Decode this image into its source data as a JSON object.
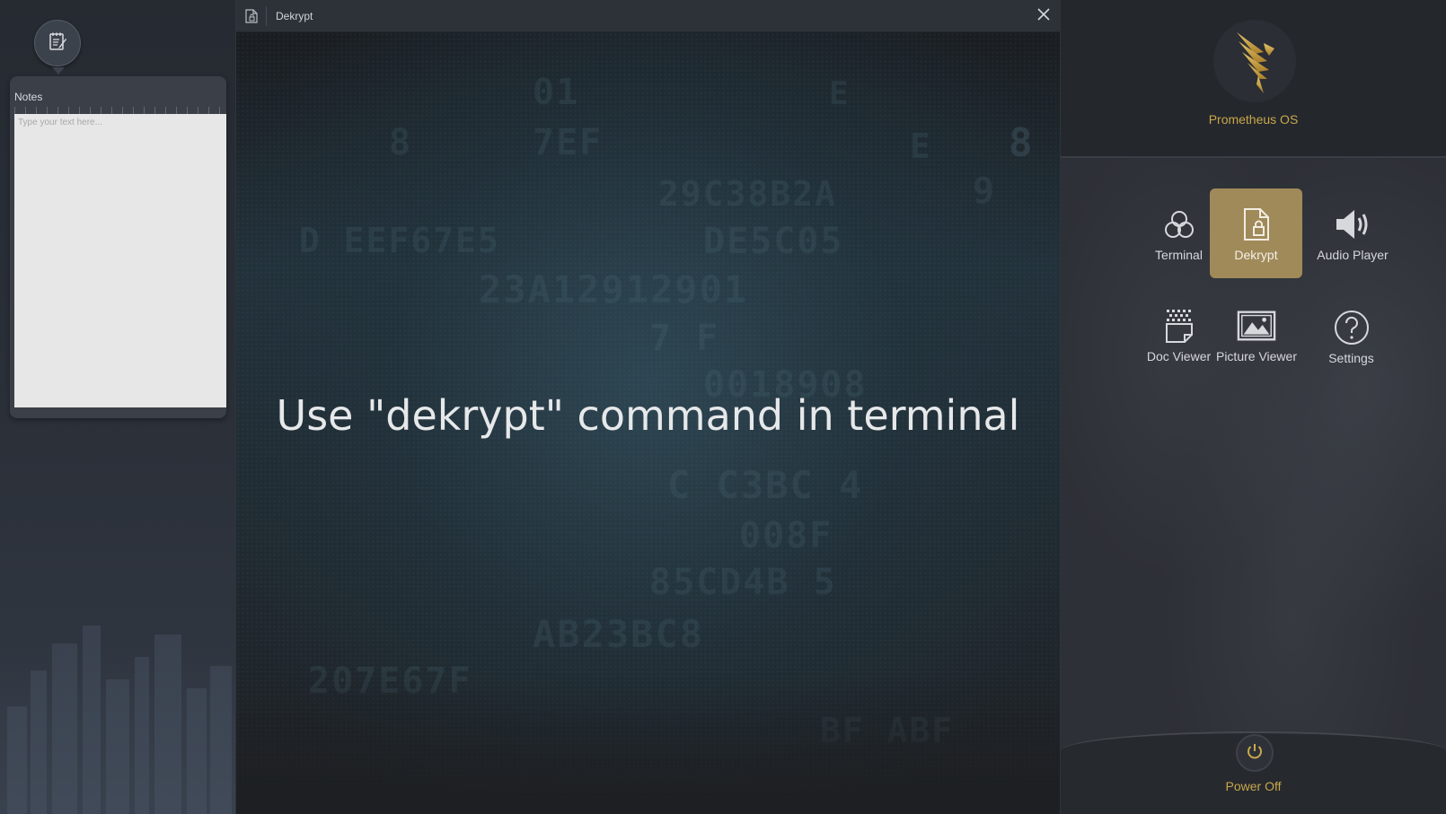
{
  "notes": {
    "title": "Notes",
    "placeholder": "Type your text here...",
    "toggle_icon": "notepad-icon"
  },
  "window": {
    "title": "Dekrypt",
    "title_icon": "file-lock-icon",
    "close_icon": "close-icon",
    "message": "Use \"dekrypt\" command in terminal"
  },
  "launcher": {
    "brand": "Prometheus OS",
    "logo_icon": "phoenix-logo-icon",
    "accent_color": "#c9a74c",
    "active_color": "#a08a5a",
    "apps": [
      {
        "label": "Terminal",
        "icon": "terminal-swirl-icon",
        "active": false
      },
      {
        "label": "Dekrypt",
        "icon": "file-lock-icon",
        "active": true
      },
      {
        "label": "Audio Player",
        "icon": "speaker-icon",
        "active": false
      },
      {
        "label": "Doc Viewer",
        "icon": "document-icon",
        "active": false
      },
      {
        "label": "Picture Viewer",
        "icon": "image-icon",
        "active": false
      },
      {
        "label": "Settings",
        "icon": "question-icon",
        "active": false
      }
    ],
    "power_label": "Power Off",
    "power_icon": "power-icon"
  }
}
